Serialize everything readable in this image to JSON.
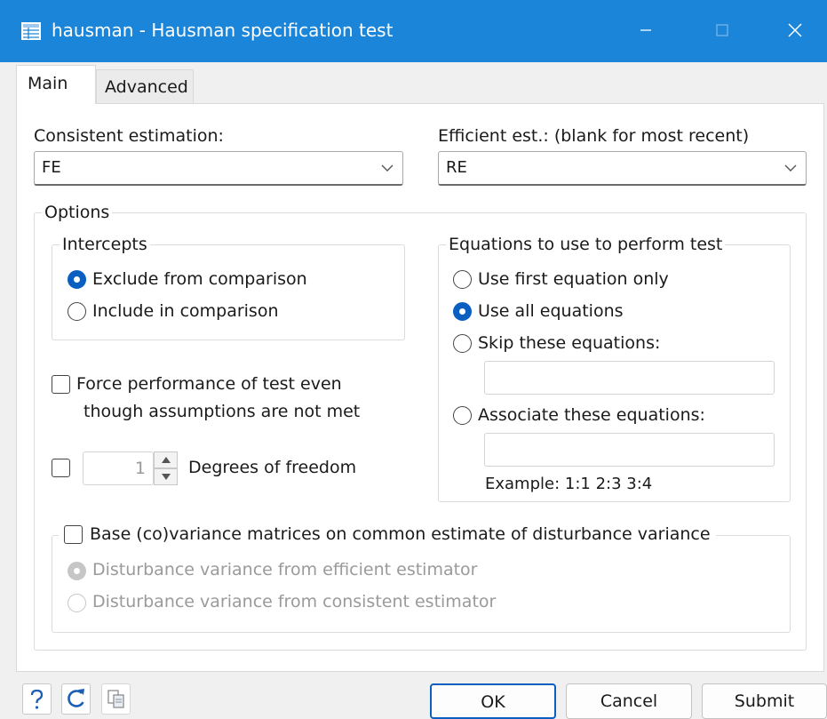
{
  "window": {
    "title": "hausman - Hausman specification test"
  },
  "tabs": [
    {
      "label": "Main",
      "active": true
    },
    {
      "label": "Advanced",
      "active": false
    }
  ],
  "consistent": {
    "label": "Consistent estimation:",
    "value": "FE"
  },
  "efficient": {
    "label": "Efficient est.:  (blank for most recent)",
    "value": "RE"
  },
  "options": {
    "legend": "Options",
    "intercepts": {
      "legend": "Intercepts",
      "exclude": "Exclude from comparison",
      "include": "Include in comparison",
      "selected": "exclude"
    },
    "force": {
      "line1": "Force performance of test even",
      "line2": "though assumptions are not met",
      "checked": false
    },
    "df": {
      "value": "1",
      "label": "Degrees of freedom",
      "checked": false
    },
    "equations": {
      "legend": "Equations to use to perform test",
      "first": "Use first equation only",
      "all": "Use all equations",
      "skip": "Skip these equations:",
      "associate": "Associate these equations:",
      "example": "Example: 1:1 2:3 3:4",
      "selected": "all"
    },
    "base": {
      "label": "Base (co)variance matrices on common estimate of disturbance variance",
      "efficient": "Disturbance variance from efficient estimator",
      "consistent": "Disturbance variance from consistent estimator",
      "checked": false
    }
  },
  "footer": {
    "ok": "OK",
    "cancel": "Cancel",
    "submit": "Submit"
  },
  "colors": {
    "titlebar": "#1b86d9",
    "accent": "#0a5fc1"
  },
  "icons": [
    "table-icon",
    "help-icon",
    "reset-icon",
    "copy-icon",
    "minimize-icon",
    "maximize-icon",
    "close-icon",
    "chevron-down-icon"
  ]
}
